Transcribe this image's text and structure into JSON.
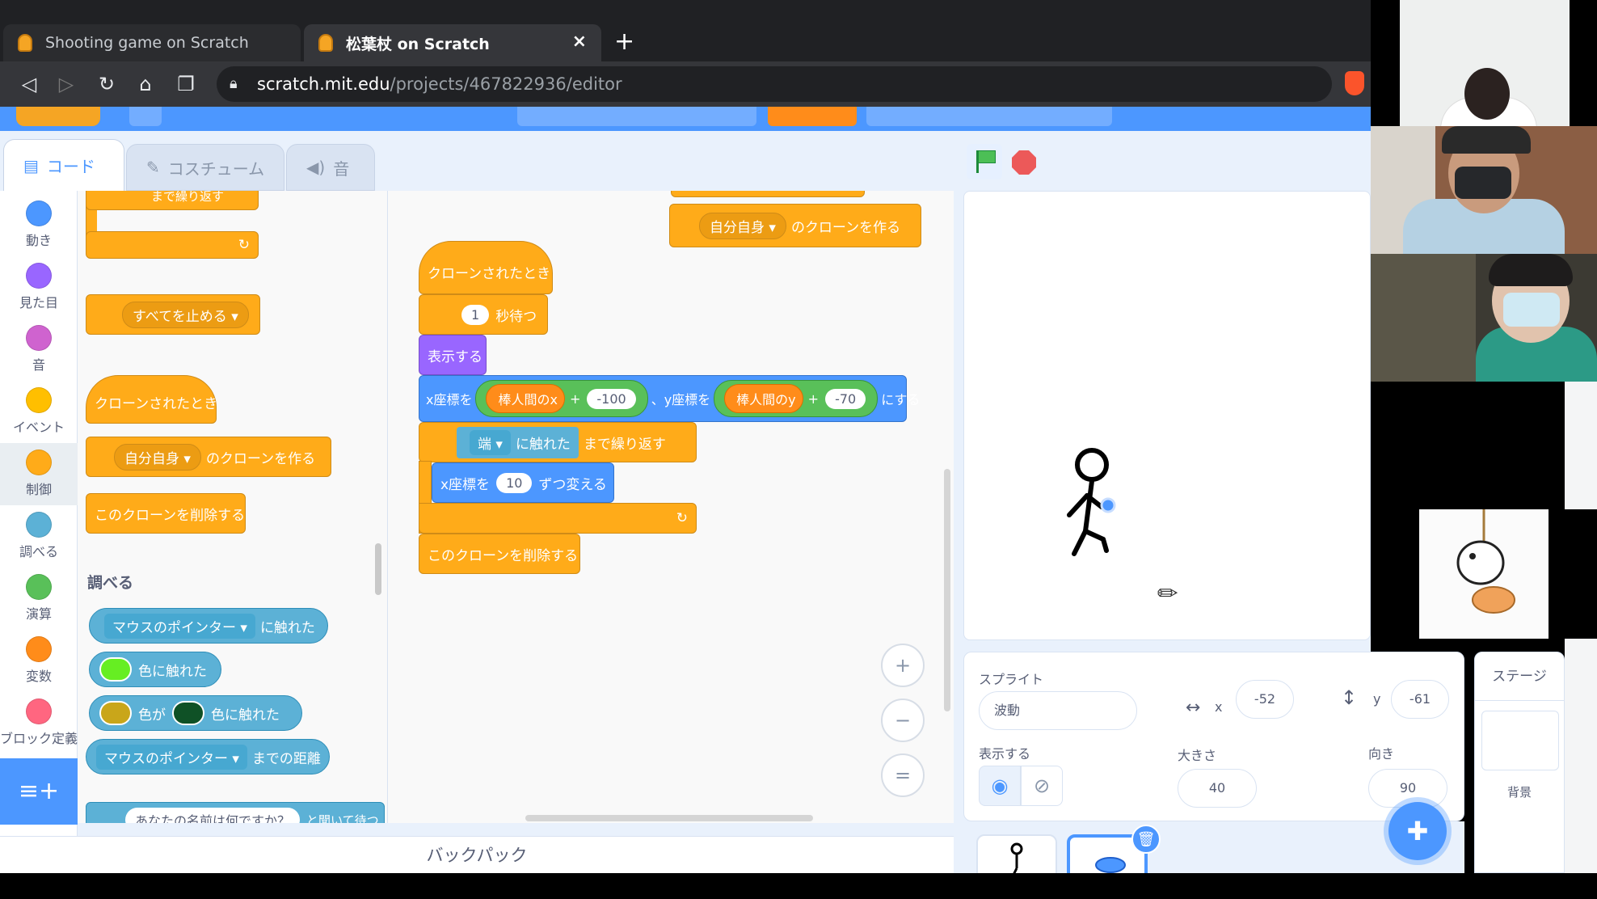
{
  "browser": {
    "tabs": [
      {
        "title": "Shooting game on Scratch"
      },
      {
        "title": "松葉杖 on Scratch"
      }
    ],
    "new_tab": "+",
    "close": "×",
    "url_host": "scratch.mit.edu",
    "url_path": "/projects/467822936/editor"
  },
  "editor_tabs": [
    "コード",
    "コスチューム",
    "音"
  ],
  "categories": [
    {
      "label": "動き",
      "color": "#4c97ff"
    },
    {
      "label": "見た目",
      "color": "#9966ff"
    },
    {
      "label": "音",
      "color": "#cf63cf"
    },
    {
      "label": "イベント",
      "color": "#ffbf00"
    },
    {
      "label": "制御",
      "color": "#ffab19"
    },
    {
      "label": "調べる",
      "color": "#5cb1d6"
    },
    {
      "label": "演算",
      "color": "#59c059"
    },
    {
      "label": "変数",
      "color": "#ff8c1a"
    },
    {
      "label": "ブロック定義",
      "color": "#ff6680"
    }
  ],
  "palette": {
    "repeat_until_tail": "まで繰り返す",
    "stop_all": "すべてを止める",
    "when_cloned": "クローンされたとき",
    "clone_prefix": "自分自身",
    "clone_suffix": "のクローンを作る",
    "delete_clone": "このクローンを削除する",
    "sensing_header": "調べる",
    "touching_dd": "マウスのポインター",
    "touching_suffix": "に触れた",
    "touch_color": "色に触れた",
    "color_is": "色が",
    "color_touch": "色に触れた",
    "distance_dd": "マウスのポインター",
    "distance_suffix": "までの距離",
    "ask_text": "あなたの名前は何ですか？",
    "ask_suffix": "と聞いて待つ"
  },
  "palette_colors": {
    "touch_color": "#66ee22",
    "color_a": "#c9a61a",
    "color_b": "#0f5126"
  },
  "script": {
    "clone_prefix": "自分自身",
    "clone_suffix": "のクローンを作る",
    "hat": "クローンされたとき",
    "wait_value": "1",
    "wait_suffix": "秒待つ",
    "show": "表示する",
    "goto_x_label": "x座標を",
    "var_x": "棒人間のx",
    "plus": "+",
    "x_offset": "-100",
    "goto_y_label": "、y座標を",
    "var_y": "棒人間のy",
    "y_offset": "-70",
    "goto_suffix": "にする",
    "edge_dd": "端",
    "touch_suffix": "に触れた",
    "until_suffix": "まで繰り返す",
    "change_x_label": "x座標を",
    "change_x_value": "10",
    "change_x_suffix": "ずつ変える",
    "delete_clone": "このクローンを削除する"
  },
  "zoom": {
    "in": "+",
    "out": "−",
    "reset": "="
  },
  "backpack": "バックパック",
  "sprite_info": {
    "sprite_label": "スプライト",
    "name": "波動",
    "x_label": "x",
    "x": "-52",
    "y_label": "y",
    "y": "-61",
    "show_label": "表示する",
    "size_label": "大きさ",
    "size": "40",
    "direction_label": "向き",
    "direction": "90"
  },
  "stage_pane": {
    "title": "ステージ",
    "backdrop_label": "背景"
  }
}
